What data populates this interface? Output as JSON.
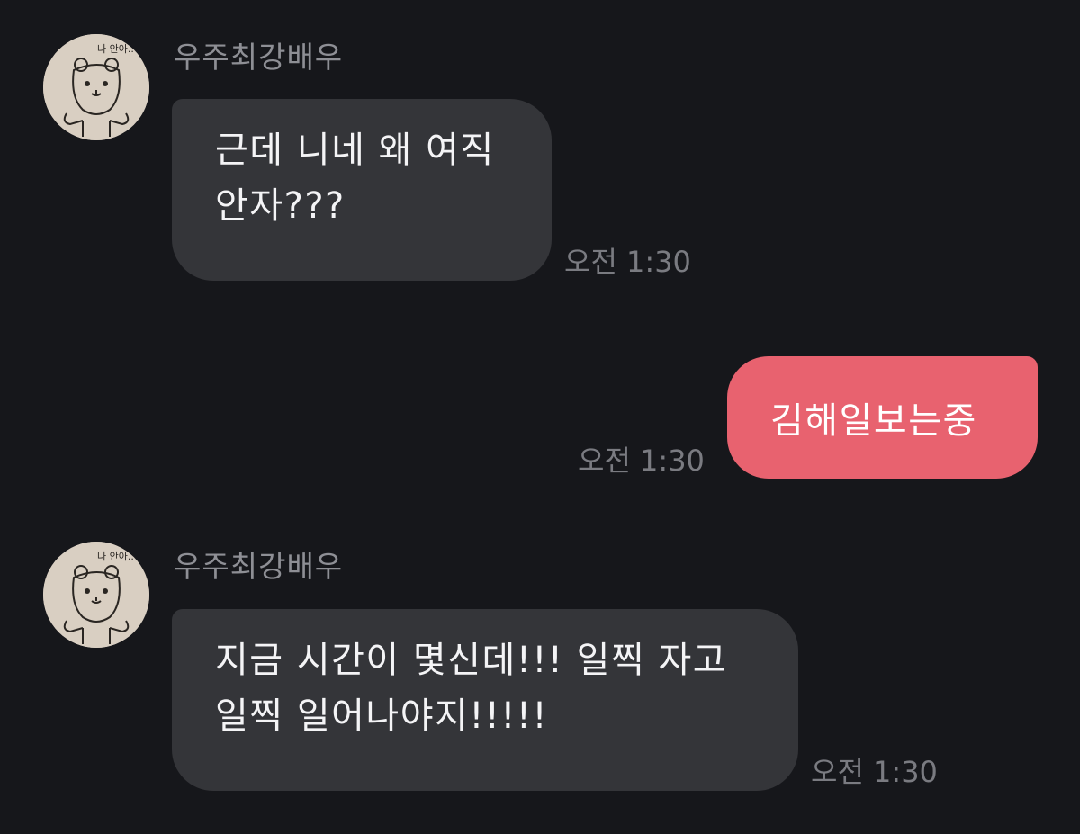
{
  "messages": [
    {
      "direction": "incoming",
      "sender": "우주최강배우",
      "avatar_icon": "bear-drawing-avatar",
      "avatar_caption": "나 안아..",
      "lines": [
        "근데 니네 왜 여직",
        "안자???"
      ],
      "time": "오전 1:30"
    },
    {
      "direction": "outgoing",
      "lines": [
        "김해일보는중"
      ],
      "time": "오전 1:30"
    },
    {
      "direction": "incoming",
      "sender": "우주최강배우",
      "avatar_icon": "bear-drawing-avatar",
      "avatar_caption": "나 안아..",
      "lines": [
        "지금 시간이 몇신데!!! 일찍 자고",
        "일찍 일어나야지!!!!!"
      ],
      "time": "오전 1:30"
    }
  ],
  "colors": {
    "background": "#16171b",
    "incoming_bubble": "#343539",
    "outgoing_bubble": "#e8626f",
    "sender_text": "#8e8f95",
    "timestamp_text": "#7a7b81"
  }
}
